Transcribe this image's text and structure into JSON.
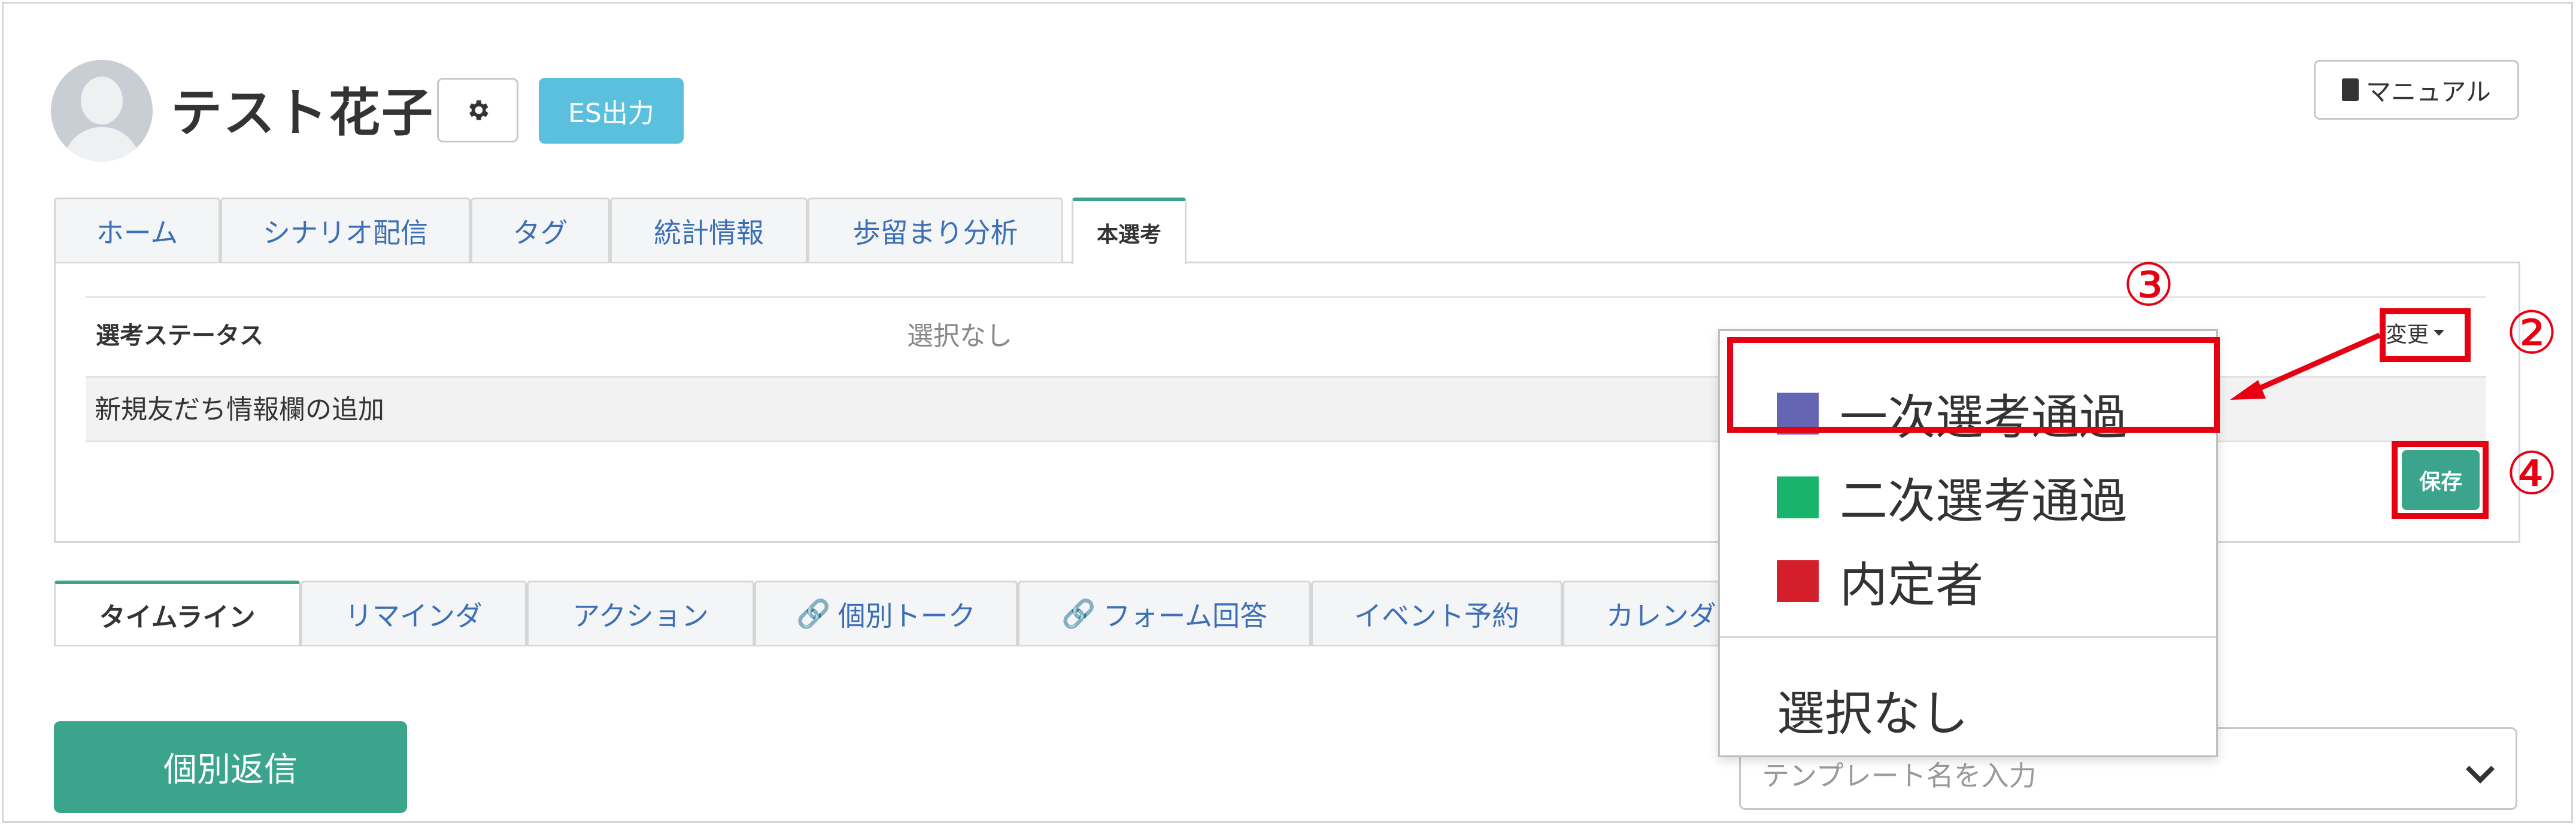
{
  "user": {
    "name": "テスト花子"
  },
  "header": {
    "es_button": "ES出力",
    "manual_button": "マニュアル"
  },
  "tabs": [
    "ホーム",
    "シナリオ配信",
    "タグ",
    "統計情報",
    "歩留まり分析",
    "本選考"
  ],
  "status_panel": {
    "label": "選考ステータス",
    "value": "選択なし",
    "change_button": "変更",
    "add_field_label": "新規友だち情報欄の追加",
    "save_button": "保存"
  },
  "dropdown": {
    "options": [
      {
        "label": "一次選考通過",
        "color": "#6466b4"
      },
      {
        "label": "二次選考通過",
        "color": "#19b46b"
      },
      {
        "label": "内定者",
        "color": "#d41e2a"
      }
    ],
    "none_option": "選択なし"
  },
  "annotations": {
    "step2": "②",
    "step3": "③",
    "step4": "④"
  },
  "lower_tabs": [
    "タイムライン",
    "リマインダ",
    "アクション",
    "個別トーク",
    "フォーム回答",
    "イベント予約",
    "カレンダ"
  ],
  "reply_button": "個別返信",
  "template_select": {
    "placeholder": "テンプレート名を入力"
  },
  "colors": {
    "accent_green": "#3aa48c",
    "es_blue": "#5bc0de",
    "annotation_red": "#e60012"
  }
}
